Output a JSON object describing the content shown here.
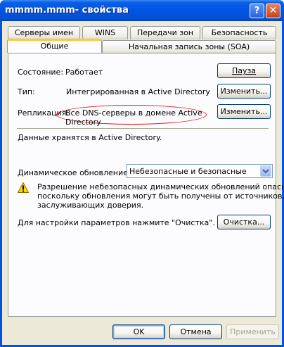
{
  "window": {
    "title": "mmmm.mmm- свойства",
    "help_label": "?",
    "close_label": "✕"
  },
  "tabs": {
    "row1": [
      "Серверы имен",
      "WINS",
      "Передачи зон",
      "Безопасность"
    ],
    "row2": [
      "Общие",
      "Начальная запись зоны (SOA)"
    ],
    "active": "Общие"
  },
  "general": {
    "status_label": "Состояние:",
    "status_value": "Работает",
    "pause_button": "Пауза",
    "type_label": "Тип:",
    "type_value": "Интегрированная в Active Directory",
    "change_type_button": "Изменить...",
    "replication_label": "Репликация:",
    "replication_value_line1": "Все DNS-серверы в домене Active",
    "replication_value_line2": "Directory",
    "change_replication_button": "Изменить...",
    "storage_note": "Данные хранятся в Active Directory.",
    "dynamic_update_label": "Динамическое обновление:",
    "dynamic_update_selected": "Небезопасные и безопасные",
    "warning_line1": "Разрешение небезопасных динамических обновлений опасно,",
    "warning_line2": "поскольку обновления могут быть получены от источников, не",
    "warning_line3": "заслуживающих доверия.",
    "aging_note": "Для настройки параметров нажмите \"Очистка\".",
    "aging_button": "Очистка..."
  },
  "footer": {
    "ok_button": "OK",
    "cancel_button": "Отмена",
    "apply_button": "Применить"
  },
  "icons": {
    "warning": "warning-icon",
    "combo_arrow": "chevron-down-icon"
  },
  "colors": {
    "titlebar": "#0054e3",
    "dialog_bg": "#ece9d8",
    "tab_highlight": "#ffc83c",
    "annotation_ellipse": "#e01818"
  }
}
